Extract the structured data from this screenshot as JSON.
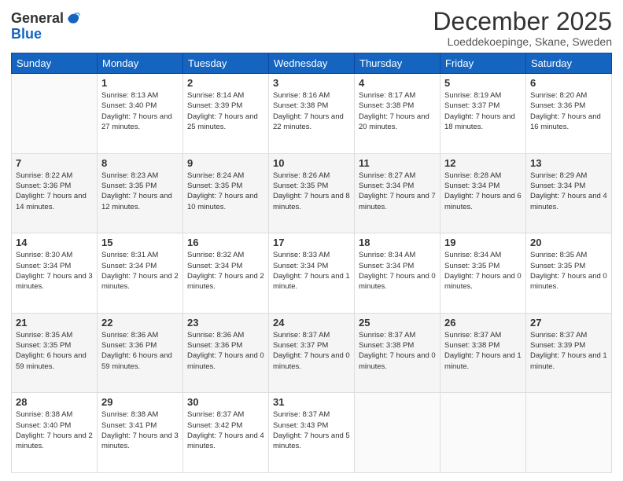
{
  "logo": {
    "general": "General",
    "blue": "Blue"
  },
  "header": {
    "month": "December 2025",
    "location": "Loeddekoepinge, Skane, Sweden"
  },
  "days": [
    "Sunday",
    "Monday",
    "Tuesday",
    "Wednesday",
    "Thursday",
    "Friday",
    "Saturday"
  ],
  "weeks": [
    [
      {
        "day": "",
        "sunrise": "",
        "sunset": "",
        "daylight": ""
      },
      {
        "day": "1",
        "sunrise": "Sunrise: 8:13 AM",
        "sunset": "Sunset: 3:40 PM",
        "daylight": "Daylight: 7 hours and 27 minutes."
      },
      {
        "day": "2",
        "sunrise": "Sunrise: 8:14 AM",
        "sunset": "Sunset: 3:39 PM",
        "daylight": "Daylight: 7 hours and 25 minutes."
      },
      {
        "day": "3",
        "sunrise": "Sunrise: 8:16 AM",
        "sunset": "Sunset: 3:38 PM",
        "daylight": "Daylight: 7 hours and 22 minutes."
      },
      {
        "day": "4",
        "sunrise": "Sunrise: 8:17 AM",
        "sunset": "Sunset: 3:38 PM",
        "daylight": "Daylight: 7 hours and 20 minutes."
      },
      {
        "day": "5",
        "sunrise": "Sunrise: 8:19 AM",
        "sunset": "Sunset: 3:37 PM",
        "daylight": "Daylight: 7 hours and 18 minutes."
      },
      {
        "day": "6",
        "sunrise": "Sunrise: 8:20 AM",
        "sunset": "Sunset: 3:36 PM",
        "daylight": "Daylight: 7 hours and 16 minutes."
      }
    ],
    [
      {
        "day": "7",
        "sunrise": "Sunrise: 8:22 AM",
        "sunset": "Sunset: 3:36 PM",
        "daylight": "Daylight: 7 hours and 14 minutes."
      },
      {
        "day": "8",
        "sunrise": "Sunrise: 8:23 AM",
        "sunset": "Sunset: 3:35 PM",
        "daylight": "Daylight: 7 hours and 12 minutes."
      },
      {
        "day": "9",
        "sunrise": "Sunrise: 8:24 AM",
        "sunset": "Sunset: 3:35 PM",
        "daylight": "Daylight: 7 hours and 10 minutes."
      },
      {
        "day": "10",
        "sunrise": "Sunrise: 8:26 AM",
        "sunset": "Sunset: 3:35 PM",
        "daylight": "Daylight: 7 hours and 8 minutes."
      },
      {
        "day": "11",
        "sunrise": "Sunrise: 8:27 AM",
        "sunset": "Sunset: 3:34 PM",
        "daylight": "Daylight: 7 hours and 7 minutes."
      },
      {
        "day": "12",
        "sunrise": "Sunrise: 8:28 AM",
        "sunset": "Sunset: 3:34 PM",
        "daylight": "Daylight: 7 hours and 6 minutes."
      },
      {
        "day": "13",
        "sunrise": "Sunrise: 8:29 AM",
        "sunset": "Sunset: 3:34 PM",
        "daylight": "Daylight: 7 hours and 4 minutes."
      }
    ],
    [
      {
        "day": "14",
        "sunrise": "Sunrise: 8:30 AM",
        "sunset": "Sunset: 3:34 PM",
        "daylight": "Daylight: 7 hours and 3 minutes."
      },
      {
        "day": "15",
        "sunrise": "Sunrise: 8:31 AM",
        "sunset": "Sunset: 3:34 PM",
        "daylight": "Daylight: 7 hours and 2 minutes."
      },
      {
        "day": "16",
        "sunrise": "Sunrise: 8:32 AM",
        "sunset": "Sunset: 3:34 PM",
        "daylight": "Daylight: 7 hours and 2 minutes."
      },
      {
        "day": "17",
        "sunrise": "Sunrise: 8:33 AM",
        "sunset": "Sunset: 3:34 PM",
        "daylight": "Daylight: 7 hours and 1 minute."
      },
      {
        "day": "18",
        "sunrise": "Sunrise: 8:34 AM",
        "sunset": "Sunset: 3:34 PM",
        "daylight": "Daylight: 7 hours and 0 minutes."
      },
      {
        "day": "19",
        "sunrise": "Sunrise: 8:34 AM",
        "sunset": "Sunset: 3:35 PM",
        "daylight": "Daylight: 7 hours and 0 minutes."
      },
      {
        "day": "20",
        "sunrise": "Sunrise: 8:35 AM",
        "sunset": "Sunset: 3:35 PM",
        "daylight": "Daylight: 7 hours and 0 minutes."
      }
    ],
    [
      {
        "day": "21",
        "sunrise": "Sunrise: 8:35 AM",
        "sunset": "Sunset: 3:35 PM",
        "daylight": "Daylight: 6 hours and 59 minutes."
      },
      {
        "day": "22",
        "sunrise": "Sunrise: 8:36 AM",
        "sunset": "Sunset: 3:36 PM",
        "daylight": "Daylight: 6 hours and 59 minutes."
      },
      {
        "day": "23",
        "sunrise": "Sunrise: 8:36 AM",
        "sunset": "Sunset: 3:36 PM",
        "daylight": "Daylight: 7 hours and 0 minutes."
      },
      {
        "day": "24",
        "sunrise": "Sunrise: 8:37 AM",
        "sunset": "Sunset: 3:37 PM",
        "daylight": "Daylight: 7 hours and 0 minutes."
      },
      {
        "day": "25",
        "sunrise": "Sunrise: 8:37 AM",
        "sunset": "Sunset: 3:38 PM",
        "daylight": "Daylight: 7 hours and 0 minutes."
      },
      {
        "day": "26",
        "sunrise": "Sunrise: 8:37 AM",
        "sunset": "Sunset: 3:38 PM",
        "daylight": "Daylight: 7 hours and 1 minute."
      },
      {
        "day": "27",
        "sunrise": "Sunrise: 8:37 AM",
        "sunset": "Sunset: 3:39 PM",
        "daylight": "Daylight: 7 hours and 1 minute."
      }
    ],
    [
      {
        "day": "28",
        "sunrise": "Sunrise: 8:38 AM",
        "sunset": "Sunset: 3:40 PM",
        "daylight": "Daylight: 7 hours and 2 minutes."
      },
      {
        "day": "29",
        "sunrise": "Sunrise: 8:38 AM",
        "sunset": "Sunset: 3:41 PM",
        "daylight": "Daylight: 7 hours and 3 minutes."
      },
      {
        "day": "30",
        "sunrise": "Sunrise: 8:37 AM",
        "sunset": "Sunset: 3:42 PM",
        "daylight": "Daylight: 7 hours and 4 minutes."
      },
      {
        "day": "31",
        "sunrise": "Sunrise: 8:37 AM",
        "sunset": "Sunset: 3:43 PM",
        "daylight": "Daylight: 7 hours and 5 minutes."
      },
      {
        "day": "",
        "sunrise": "",
        "sunset": "",
        "daylight": ""
      },
      {
        "day": "",
        "sunrise": "",
        "sunset": "",
        "daylight": ""
      },
      {
        "day": "",
        "sunrise": "",
        "sunset": "",
        "daylight": ""
      }
    ]
  ]
}
